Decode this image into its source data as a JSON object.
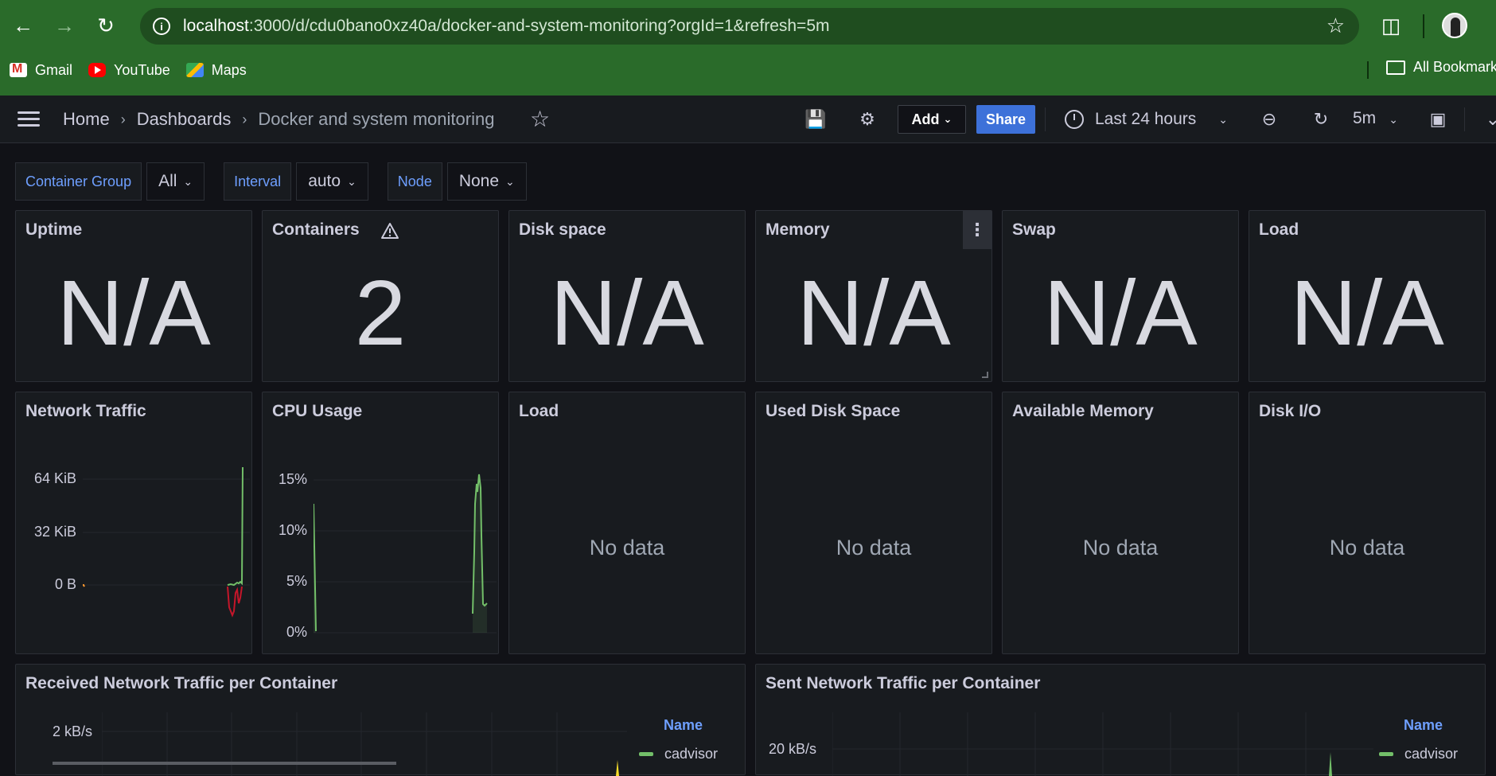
{
  "browser": {
    "url_host": "localhost",
    "url_rest": ":3000/d/cdu0bano0xz40a/docker-and-system-monitoring?orgId=1&refresh=5m",
    "bookmarks": [
      "Gmail",
      "YouTube",
      "Maps"
    ],
    "all_bookmarks": "All Bookmarks"
  },
  "grafana_nav": {
    "breadcrumbs": [
      "Home",
      "Dashboards",
      "Docker and system monitoring"
    ],
    "add_label": "Add",
    "share_label": "Share",
    "time_range": "Last 24 hours",
    "refresh_interval": "5m"
  },
  "variables": [
    {
      "label": "Container Group",
      "value": "All"
    },
    {
      "label": "Interval",
      "value": "auto"
    },
    {
      "label": "Node",
      "value": "None"
    }
  ],
  "stat_panels": [
    {
      "title": "Uptime",
      "value": "N/A"
    },
    {
      "title": "Containers",
      "value": "2"
    },
    {
      "title": "Disk space",
      "value": "N/A"
    },
    {
      "title": "Memory",
      "value": "N/A"
    },
    {
      "title": "Swap",
      "value": "N/A"
    },
    {
      "title": "Load",
      "value": "N/A"
    }
  ],
  "row2_panels": [
    {
      "title": "Network Traffic"
    },
    {
      "title": "CPU Usage"
    },
    {
      "title": "Load",
      "no_data": "No data"
    },
    {
      "title": "Used Disk Space",
      "no_data": "No data"
    },
    {
      "title": "Available Memory",
      "no_data": "No data"
    },
    {
      "title": "Disk I/O",
      "no_data": "No data"
    }
  ],
  "network_traffic": {
    "y_ticks": [
      "64 KiB",
      "32 KiB",
      "0 B"
    ],
    "colors": {
      "received": "#73bf69",
      "sent": "#c4162a"
    }
  },
  "cpu_usage": {
    "y_ticks": [
      "15%",
      "10%",
      "5%",
      "0%"
    ],
    "color": "#73bf69"
  },
  "row3_panels": [
    {
      "title": "Received Network Traffic per Container",
      "y_tick": "2 kB/s",
      "legend_head": "Name",
      "legend_item": "cadvisor"
    },
    {
      "title": "Sent Network Traffic per Container",
      "y_tick": "20 kB/s",
      "legend_head": "Name",
      "legend_item": "cadvisor"
    }
  ],
  "colors": {
    "accent": "#3d71d9",
    "series_green": "#73bf69",
    "series_yellow": "#fade2a",
    "browser_green": "#2a6b2a"
  }
}
